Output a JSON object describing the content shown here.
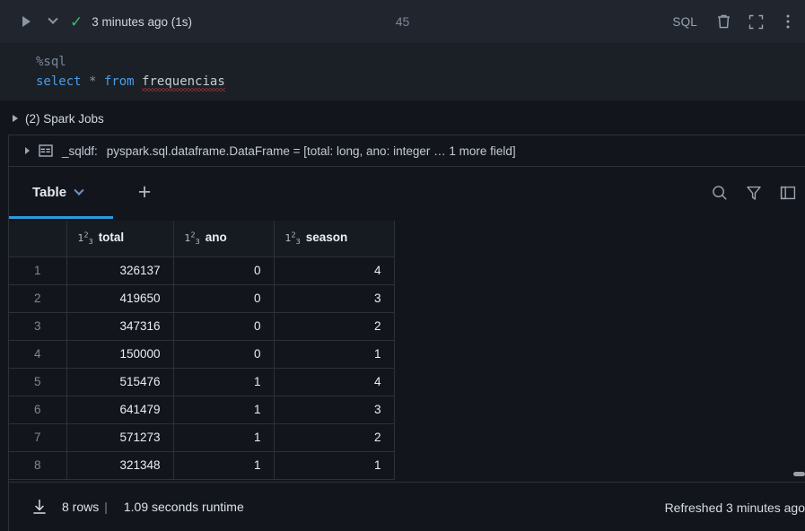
{
  "toolbar": {
    "run_icon": "play-triangle-icon",
    "dropdown_icon": "chevron-down-icon",
    "status_icon": "success-check-icon",
    "status_text": "3 minutes ago (1s)",
    "cell_number": "45",
    "sql_badge": "SQL",
    "delete_icon": "trash-icon",
    "fullscreen_icon": "expand-icon",
    "more_icon": "kebab-menu-icon"
  },
  "editor": {
    "line1": "%sql",
    "line2": {
      "kw_select": "select",
      "star": "*",
      "kw_from": "from",
      "table": "frequencias"
    }
  },
  "spark_jobs": {
    "label": "(2) Spark Jobs",
    "expander_icon": "triangle-right-icon"
  },
  "dataframe": {
    "expander_icon": "triangle-right-icon",
    "type_icon": "table-icon",
    "name": "_sqldf:",
    "signature": "pyspark.sql.dataframe.DataFrame = [total: long, ano: integer … 1 more field]"
  },
  "results": {
    "tabs": [
      {
        "label": "Table",
        "chevron_icon": "chevron-down-icon",
        "active": true
      }
    ],
    "add_tab_label": "+",
    "tools": [
      {
        "name": "search-icon"
      },
      {
        "name": "filter-icon"
      },
      {
        "name": "panel-toggle-icon"
      }
    ]
  },
  "table": {
    "type_icon_label": "1²3",
    "columns": [
      {
        "key": "index",
        "label": ""
      },
      {
        "key": "total",
        "label": "total",
        "type": "numeric"
      },
      {
        "key": "ano",
        "label": "ano",
        "type": "numeric"
      },
      {
        "key": "season",
        "label": "season",
        "type": "numeric"
      }
    ],
    "rows": [
      {
        "index": "1",
        "total": "326137",
        "ano": "0",
        "season": "4"
      },
      {
        "index": "2",
        "total": "419650",
        "ano": "0",
        "season": "3"
      },
      {
        "index": "3",
        "total": "347316",
        "ano": "0",
        "season": "2"
      },
      {
        "index": "4",
        "total": "150000",
        "ano": "0",
        "season": "1"
      },
      {
        "index": "5",
        "total": "515476",
        "ano": "1",
        "season": "4"
      },
      {
        "index": "6",
        "total": "641479",
        "ano": "1",
        "season": "3"
      },
      {
        "index": "7",
        "total": "571273",
        "ano": "1",
        "season": "2"
      },
      {
        "index": "8",
        "total": "321348",
        "ano": "1",
        "season": "1"
      }
    ]
  },
  "footer": {
    "download_icon": "download-icon",
    "row_count": "8 rows",
    "separator": "|",
    "runtime": "1.09 seconds runtime",
    "refreshed": "Refreshed 3 minutes ago"
  },
  "colors": {
    "accent_blue": "#2e9ade",
    "success_green": "#3cbb6c",
    "background": "#12161c",
    "toolbar_bg": "#21262e",
    "editor_bg": "#1b2026",
    "border": "#2b323c",
    "keyword_blue": "#4a9ce8",
    "error_red": "#e03c3c"
  }
}
